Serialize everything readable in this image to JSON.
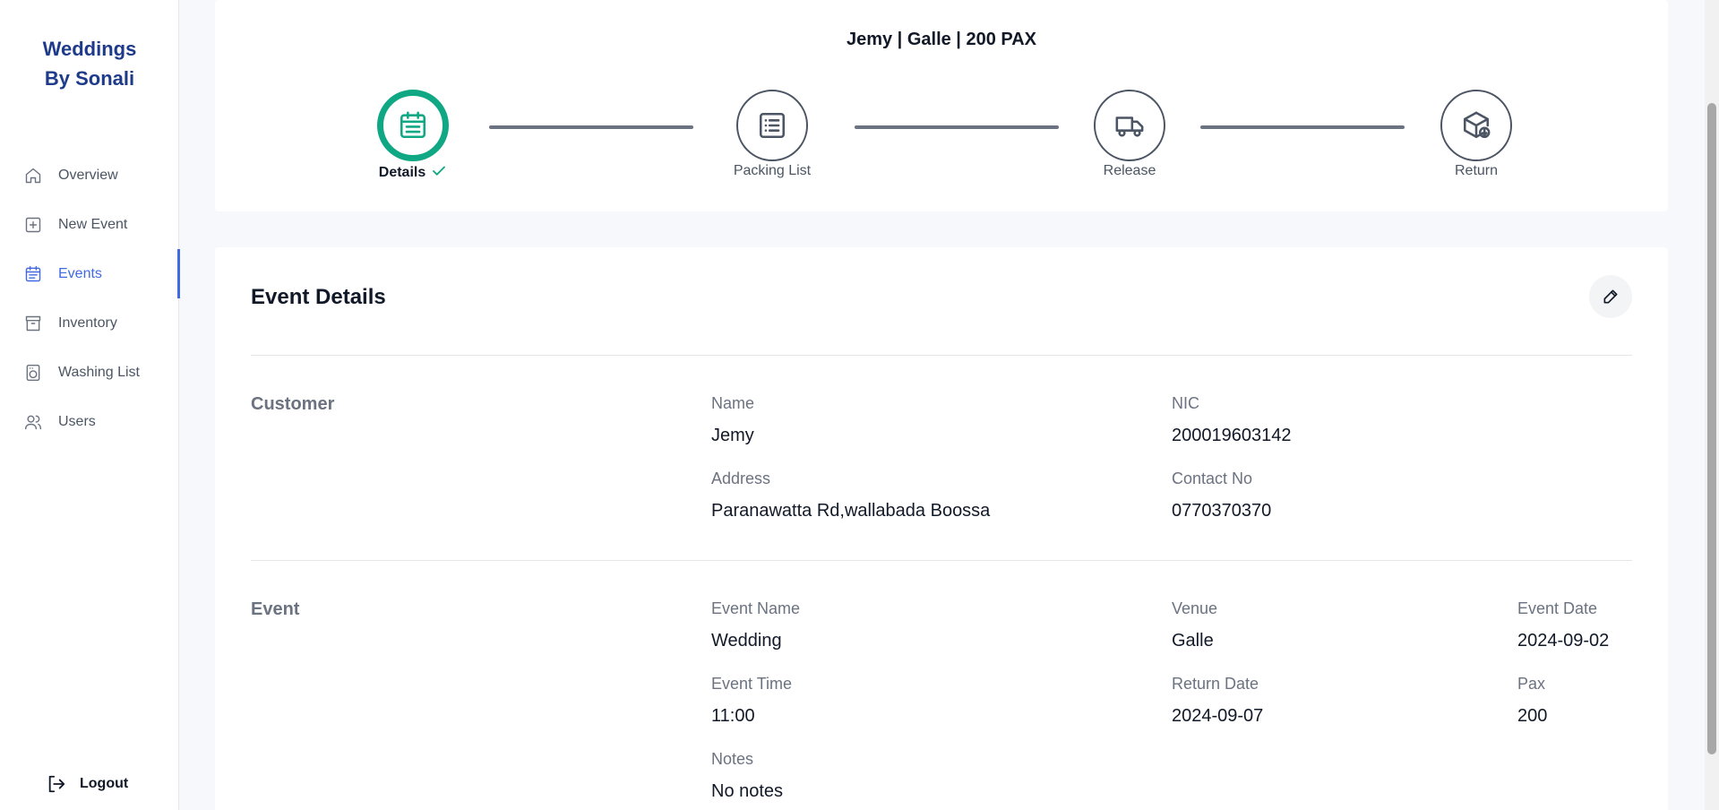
{
  "app": {
    "brand_line1": "Weddings",
    "brand_line2": "By Sonali"
  },
  "sidebar": {
    "items": [
      {
        "label": "Overview",
        "icon": "home-icon",
        "active": false
      },
      {
        "label": "New Event",
        "icon": "plus-square-icon",
        "active": false
      },
      {
        "label": "Events",
        "icon": "calendar-icon",
        "active": true
      },
      {
        "label": "Inventory",
        "icon": "archive-icon",
        "active": false
      },
      {
        "label": "Washing List",
        "icon": "washing-machine-icon",
        "active": false
      },
      {
        "label": "Users",
        "icon": "users-icon",
        "active": false
      }
    ],
    "logout_label": "Logout"
  },
  "progress": {
    "title": "Jemy | Galle | 200 PAX",
    "steps": [
      {
        "label": "Details",
        "icon": "calendar-list-icon",
        "status": "complete"
      },
      {
        "label": "Packing List",
        "icon": "list-icon",
        "status": "pending"
      },
      {
        "label": "Release",
        "icon": "truck-icon",
        "status": "pending"
      },
      {
        "label": "Return",
        "icon": "box-return-icon",
        "status": "pending"
      }
    ]
  },
  "details": {
    "heading": "Event Details",
    "customer": {
      "section_title": "Customer",
      "name_label": "Name",
      "name": "Jemy",
      "nic_label": "NIC",
      "nic": "200019603142",
      "address_label": "Address",
      "address": "Paranawatta Rd,wallabada Boossa",
      "contact_label": "Contact No",
      "contact": "0770370370"
    },
    "event": {
      "section_title": "Event",
      "name_label": "Event Name",
      "name": "Wedding",
      "venue_label": "Venue",
      "venue": "Galle",
      "date_label": "Event Date",
      "date": "2024-09-02",
      "time_label": "Event Time",
      "time": "11:00",
      "return_label": "Return Date",
      "return_date": "2024-09-07",
      "pax_label": "Pax",
      "pax": "200",
      "notes_label": "Notes",
      "notes": "No notes"
    }
  },
  "colors": {
    "accent": "#4169e1",
    "success": "#10a884",
    "brand": "#1e3a8a"
  }
}
